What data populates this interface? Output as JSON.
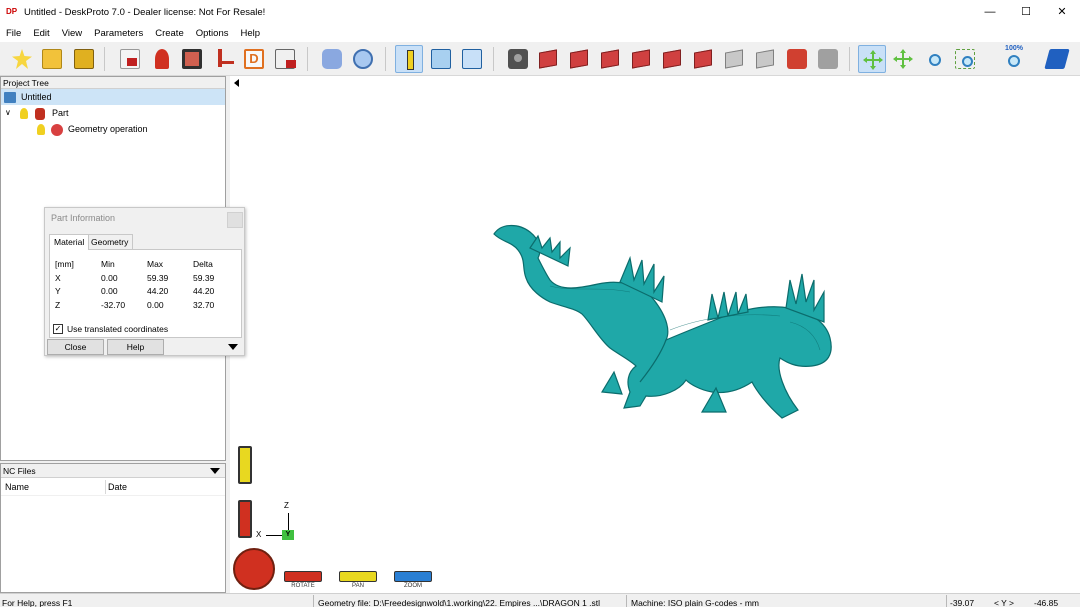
{
  "window": {
    "title": "Untitled - DeskProto 7.0 - Dealer license: Not For Resale!",
    "app_icon_text": "DP",
    "controls": [
      "minimize",
      "maximize",
      "close"
    ]
  },
  "menu": [
    "File",
    "Edit",
    "View",
    "Parameters",
    "Create",
    "Options",
    "Help"
  ],
  "toolbar": {
    "zoom_percent_label": "100%"
  },
  "project_tree": {
    "header": "Project Tree",
    "items": [
      {
        "label": "Untitled",
        "level": 0,
        "selected": true
      },
      {
        "label": "Part",
        "level": 1,
        "selected": false
      },
      {
        "label": "Geometry operation",
        "level": 2,
        "selected": false
      }
    ]
  },
  "nc_files": {
    "header": "NC Files",
    "columns": [
      "Name",
      "Date"
    ]
  },
  "part_info": {
    "title": "Part Information",
    "tabs": [
      "Material",
      "Geometry"
    ],
    "active_tab": "Material",
    "table": {
      "headers": [
        "[mm]",
        "Min",
        "Max",
        "Delta"
      ],
      "rows": [
        [
          "X",
          "0.00",
          "59.39",
          "59.39"
        ],
        [
          "Y",
          "0.00",
          "44.20",
          "44.20"
        ],
        [
          "Z",
          "-32.70",
          "0.00",
          "32.70"
        ]
      ]
    },
    "checkbox_label": "Use translated coordinates",
    "checkbox_checked": true,
    "buttons": {
      "close": "Close",
      "help": "Help"
    }
  },
  "view_controls": {
    "rotate_label": "ROTATE",
    "pan_label": "PAN",
    "zoom_label": "ZOOM"
  },
  "axes": {
    "z": "Z",
    "x": "X",
    "y": "Y"
  },
  "status": {
    "help": "For Help, press F1",
    "geometry_file": "Geometry file: D:\\Freedesignwold\\1.working\\22. Empires ...\\DRAGON 1 .stl",
    "machine": "Machine: ISO plain G-codes - mm",
    "x_coord": "-39.07",
    "axis_label": "< Y >",
    "y_coord": "-46.85"
  },
  "colors": {
    "model": "#1fa8a8",
    "selection": "#cde4f7",
    "accent": "#2a7fd4"
  }
}
